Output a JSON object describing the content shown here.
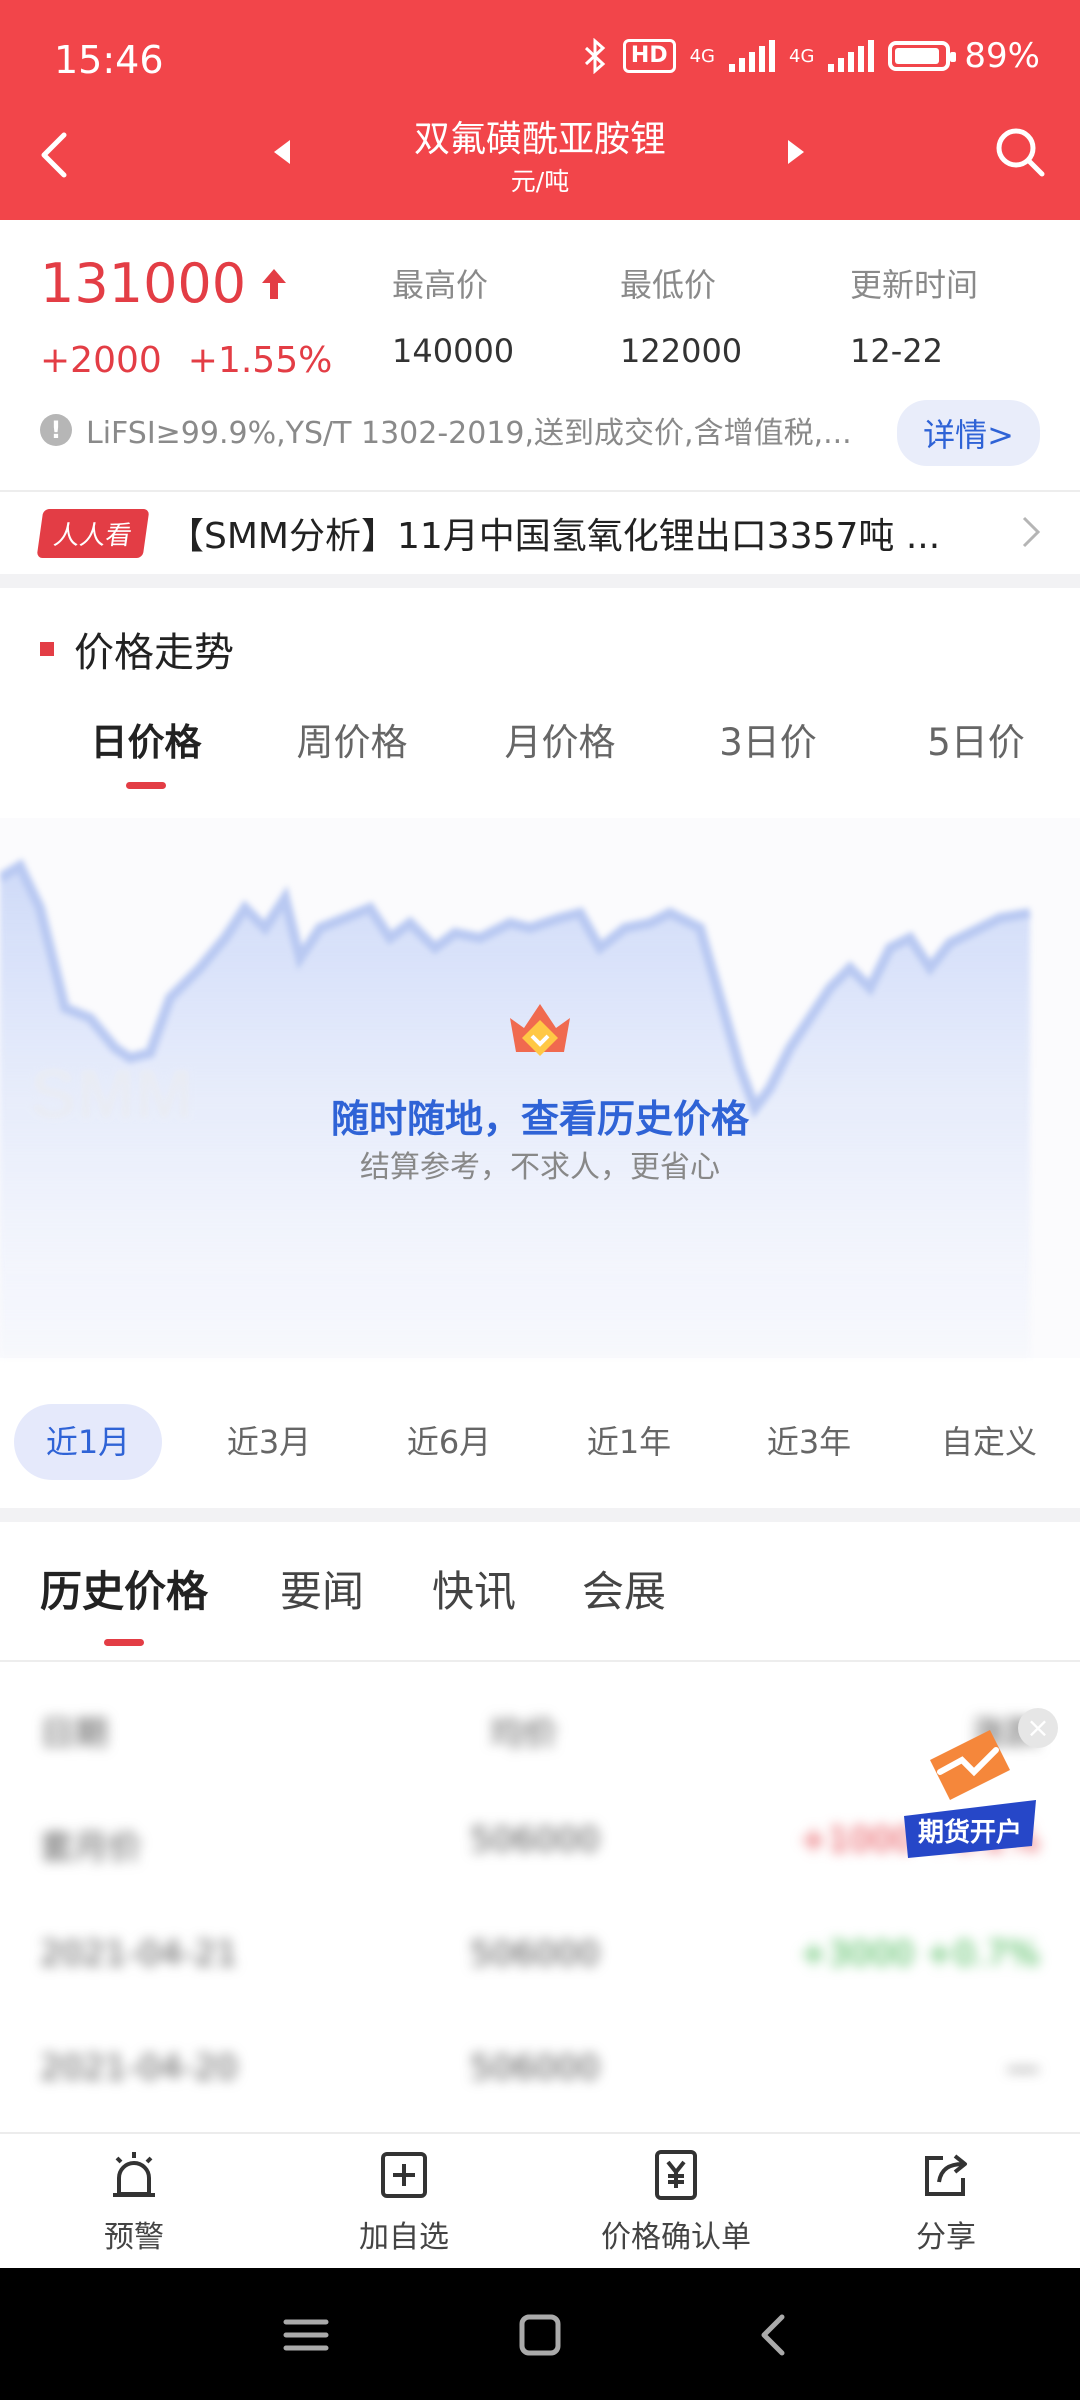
{
  "status_bar": {
    "time": "15:46",
    "network": "4G",
    "battery": "89%"
  },
  "nav": {
    "title": "双氟磺酰亚胺锂",
    "subtitle": "元/吨"
  },
  "price": {
    "current": "131000",
    "change": "+2000",
    "change_pct": "+1.55%",
    "high_label": "最高价",
    "high": "140000",
    "low_label": "最低价",
    "low": "122000",
    "update_label": "更新时间",
    "update": "12-22",
    "note": "LiFSI≥99.9%,YS/T 1302-2019,送到成交价,含增值税,...",
    "detail_button": "详情>"
  },
  "ticker": {
    "badge": "人人看",
    "text": "【SMM分析】11月中国氢氧化锂出口3357吨 ..."
  },
  "trend": {
    "title": "价格走势",
    "period_tabs": [
      "日价格",
      "周价格",
      "月价格",
      "3日价",
      "5日价"
    ],
    "active_period": 0,
    "promo_title": "随时随地，查看历史价格",
    "promo_sub": "结算参考，不求人，更省心",
    "watermark": "SMM",
    "range_tabs": [
      "近1月",
      "近3月",
      "近6月",
      "近1年",
      "近3年",
      "自定义"
    ],
    "active_range": 0
  },
  "section_tabs": [
    "历史价格",
    "要闻",
    "快讯",
    "会展"
  ],
  "history_rows": [
    {
      "date": "日期",
      "price": "均价",
      "change": "涨跌"
    },
    {
      "date": "套月价",
      "price": "506000",
      "change": "+1000 +0.2%"
    },
    {
      "date": "2021-04-21",
      "price": "506000",
      "change": "+3000 +0.7%"
    },
    {
      "date": "2021-04-20",
      "price": "506000",
      "change": "—"
    }
  ],
  "futures_button": "期货开户",
  "toolbar": {
    "alert": "预警",
    "add_watch": "加自选",
    "confirm": "价格确认单",
    "share": "分享"
  },
  "colors": {
    "brand_red": "#f2454a",
    "up_red": "#e33d45",
    "link_blue": "#2f63d6"
  }
}
